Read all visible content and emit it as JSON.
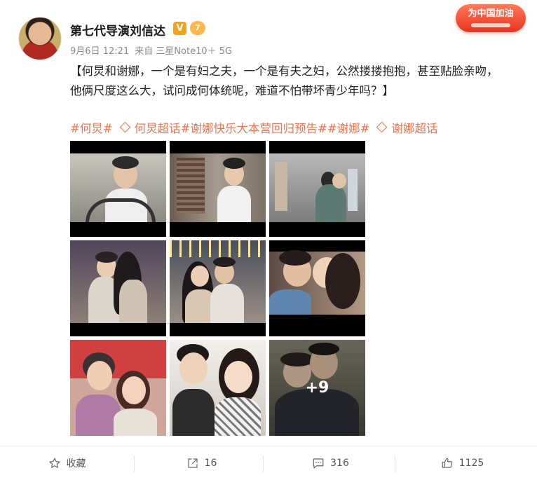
{
  "post": {
    "author": "第七代导演刘信达",
    "verified_badge": "V",
    "level_badge": "7",
    "meta": {
      "date": "9月6日 12:21",
      "source_prefix": "来自",
      "device": "三星Note10＋ 5G"
    },
    "promo_badge": "为中国加油",
    "content": "【何炅和谢娜，一个是有妇之夫，一个是有夫之妇，公然搂搂抱抱，甚至贴脸亲吻，他俩尺度这么大，试问成何体统呢，难道不怕带坏青少年吗？】",
    "tags": [
      "#何炅#",
      "何炅超话",
      "#谢娜快乐大本营回归预告#",
      "#谢娜#",
      "谢娜超话"
    ],
    "tag_superchat_flags": [
      false,
      true,
      false,
      false,
      true
    ],
    "images_more": "+9"
  },
  "actions": {
    "favorite": "收藏",
    "repost": "16",
    "comment": "316",
    "like": "1125"
  },
  "colors": {
    "tag": "#eb7350",
    "meta": "#8a8a8a",
    "promo": "#e8321f"
  },
  "icons": [
    "star-icon",
    "repost-icon",
    "comment-icon",
    "like-icon",
    "superchat-diamond-icon"
  ]
}
